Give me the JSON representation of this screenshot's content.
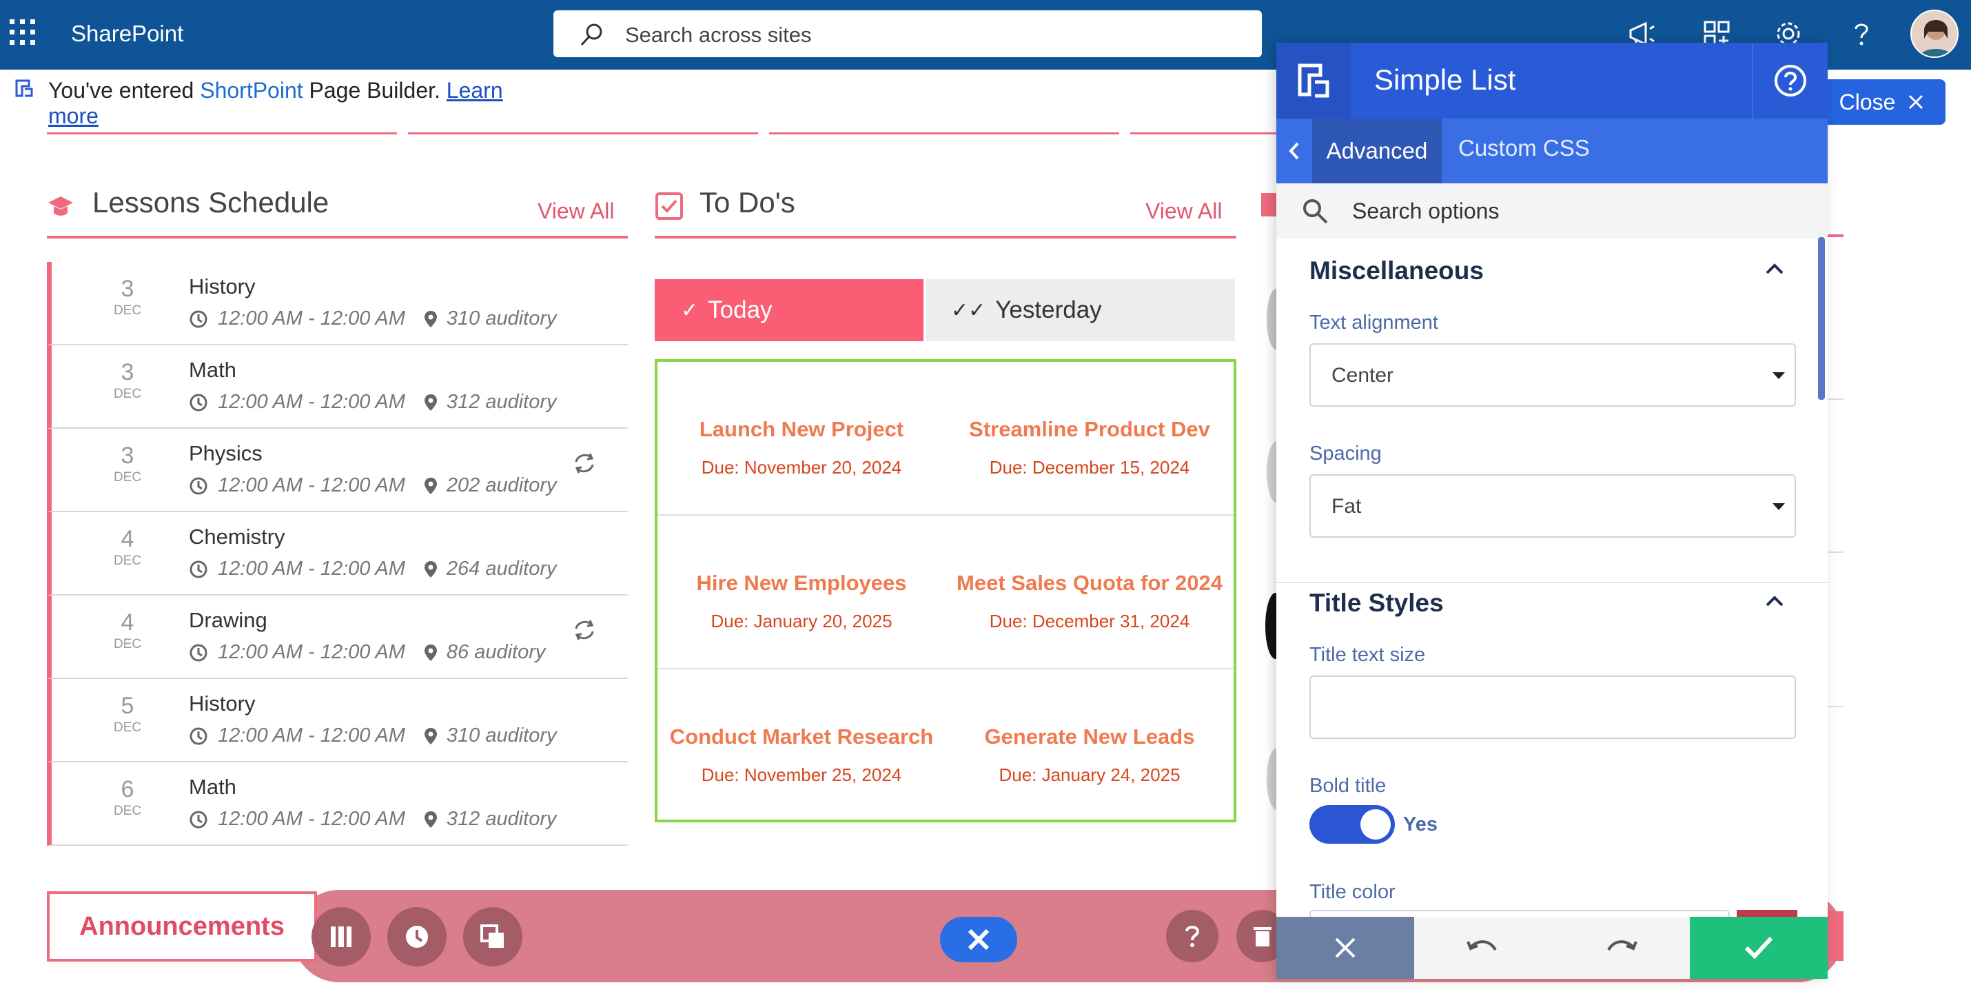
{
  "suite": {
    "app_name": "SharePoint",
    "search_placeholder": "Search across sites"
  },
  "notice": {
    "prefix": "You've entered ",
    "brand": "ShortPoint",
    "suffix": " Page Builder. ",
    "link": "Learn more"
  },
  "close_button": "Close",
  "lessons": {
    "title": "Lessons Schedule",
    "view_all": "View All",
    "items": [
      {
        "day": "3",
        "month": "DEC",
        "subject": "History",
        "time": "12:00 AM - 12:00 AM",
        "location": "310 auditory",
        "recurring": false
      },
      {
        "day": "3",
        "month": "DEC",
        "subject": "Math",
        "time": "12:00 AM - 12:00 AM",
        "location": "312 auditory",
        "recurring": false
      },
      {
        "day": "3",
        "month": "DEC",
        "subject": "Physics",
        "time": "12:00 AM - 12:00 AM",
        "location": "202 auditory",
        "recurring": true
      },
      {
        "day": "4",
        "month": "DEC",
        "subject": "Chemistry",
        "time": "12:00 AM - 12:00 AM",
        "location": "264 auditory",
        "recurring": false
      },
      {
        "day": "4",
        "month": "DEC",
        "subject": "Drawing",
        "time": "12:00 AM - 12:00 AM",
        "location": "86 auditory",
        "recurring": true
      },
      {
        "day": "5",
        "month": "DEC",
        "subject": "History",
        "time": "12:00 AM - 12:00 AM",
        "location": "310 auditory",
        "recurring": false
      },
      {
        "day": "6",
        "month": "DEC",
        "subject": "Math",
        "time": "12:00 AM - 12:00 AM",
        "location": "312 auditory",
        "recurring": false
      }
    ]
  },
  "todos": {
    "title": "To Do's",
    "view_all": "View All",
    "tab_today": "Today",
    "tab_yesterday": "Yesterday",
    "rows": [
      [
        {
          "title": "Launch New Project",
          "due": "Due: November 20, 2024"
        },
        {
          "title": "Streamline Product Dev",
          "due": "Due: December 15, 2024"
        }
      ],
      [
        {
          "title": "Hire New Employees",
          "due": "Due: January 20, 2025"
        },
        {
          "title": "Meet Sales Quota for 2024",
          "due": "Due: December 31, 2024"
        }
      ],
      [
        {
          "title": "Conduct Market Research",
          "due": "Due: November 25, 2024"
        },
        {
          "title": "Generate New Leads",
          "due": "Due: January 24, 2025"
        }
      ]
    ]
  },
  "announcements": "Announcements",
  "panel": {
    "title": "Simple List",
    "tab_advanced": "Advanced",
    "tab_custom_css": "Custom CSS",
    "search_placeholder": "Search options",
    "misc": {
      "title": "Miscellaneous",
      "text_alignment_label": "Text alignment",
      "text_alignment_value": "Center",
      "spacing_label": "Spacing",
      "spacing_value": "Fat"
    },
    "title_styles": {
      "title": "Title Styles",
      "text_size_label": "Title text size",
      "text_size_value": "",
      "bold_label": "Bold title",
      "bold_value": "Yes",
      "color_label": "Title color"
    }
  },
  "colors": {
    "suite_bar": "#0f5496",
    "accent_red": "#ee6a7c",
    "panel_blue": "#2a5bd7",
    "confirm_green": "#1fbf7c",
    "todo_border": "#8ad54b"
  }
}
